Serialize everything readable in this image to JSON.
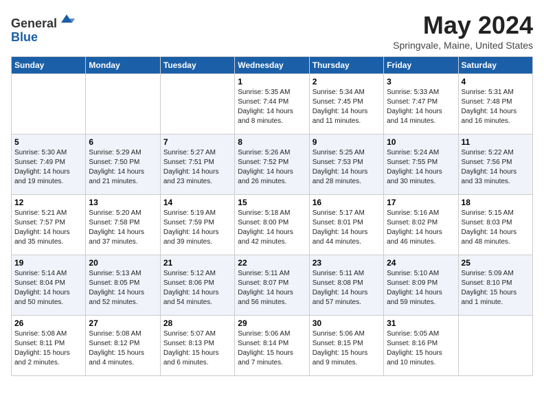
{
  "header": {
    "logo_line1": "General",
    "logo_line2": "Blue",
    "month_title": "May 2024",
    "location": "Springvale, Maine, United States"
  },
  "weekdays": [
    "Sunday",
    "Monday",
    "Tuesday",
    "Wednesday",
    "Thursday",
    "Friday",
    "Saturday"
  ],
  "weeks": [
    [
      {
        "day": "",
        "content": ""
      },
      {
        "day": "",
        "content": ""
      },
      {
        "day": "",
        "content": ""
      },
      {
        "day": "1",
        "content": "Sunrise: 5:35 AM\nSunset: 7:44 PM\nDaylight: 14 hours\nand 8 minutes."
      },
      {
        "day": "2",
        "content": "Sunrise: 5:34 AM\nSunset: 7:45 PM\nDaylight: 14 hours\nand 11 minutes."
      },
      {
        "day": "3",
        "content": "Sunrise: 5:33 AM\nSunset: 7:47 PM\nDaylight: 14 hours\nand 14 minutes."
      },
      {
        "day": "4",
        "content": "Sunrise: 5:31 AM\nSunset: 7:48 PM\nDaylight: 14 hours\nand 16 minutes."
      }
    ],
    [
      {
        "day": "5",
        "content": "Sunrise: 5:30 AM\nSunset: 7:49 PM\nDaylight: 14 hours\nand 19 minutes."
      },
      {
        "day": "6",
        "content": "Sunrise: 5:29 AM\nSunset: 7:50 PM\nDaylight: 14 hours\nand 21 minutes."
      },
      {
        "day": "7",
        "content": "Sunrise: 5:27 AM\nSunset: 7:51 PM\nDaylight: 14 hours\nand 23 minutes."
      },
      {
        "day": "8",
        "content": "Sunrise: 5:26 AM\nSunset: 7:52 PM\nDaylight: 14 hours\nand 26 minutes."
      },
      {
        "day": "9",
        "content": "Sunrise: 5:25 AM\nSunset: 7:53 PM\nDaylight: 14 hours\nand 28 minutes."
      },
      {
        "day": "10",
        "content": "Sunrise: 5:24 AM\nSunset: 7:55 PM\nDaylight: 14 hours\nand 30 minutes."
      },
      {
        "day": "11",
        "content": "Sunrise: 5:22 AM\nSunset: 7:56 PM\nDaylight: 14 hours\nand 33 minutes."
      }
    ],
    [
      {
        "day": "12",
        "content": "Sunrise: 5:21 AM\nSunset: 7:57 PM\nDaylight: 14 hours\nand 35 minutes."
      },
      {
        "day": "13",
        "content": "Sunrise: 5:20 AM\nSunset: 7:58 PM\nDaylight: 14 hours\nand 37 minutes."
      },
      {
        "day": "14",
        "content": "Sunrise: 5:19 AM\nSunset: 7:59 PM\nDaylight: 14 hours\nand 39 minutes."
      },
      {
        "day": "15",
        "content": "Sunrise: 5:18 AM\nSunset: 8:00 PM\nDaylight: 14 hours\nand 42 minutes."
      },
      {
        "day": "16",
        "content": "Sunrise: 5:17 AM\nSunset: 8:01 PM\nDaylight: 14 hours\nand 44 minutes."
      },
      {
        "day": "17",
        "content": "Sunrise: 5:16 AM\nSunset: 8:02 PM\nDaylight: 14 hours\nand 46 minutes."
      },
      {
        "day": "18",
        "content": "Sunrise: 5:15 AM\nSunset: 8:03 PM\nDaylight: 14 hours\nand 48 minutes."
      }
    ],
    [
      {
        "day": "19",
        "content": "Sunrise: 5:14 AM\nSunset: 8:04 PM\nDaylight: 14 hours\nand 50 minutes."
      },
      {
        "day": "20",
        "content": "Sunrise: 5:13 AM\nSunset: 8:05 PM\nDaylight: 14 hours\nand 52 minutes."
      },
      {
        "day": "21",
        "content": "Sunrise: 5:12 AM\nSunset: 8:06 PM\nDaylight: 14 hours\nand 54 minutes."
      },
      {
        "day": "22",
        "content": "Sunrise: 5:11 AM\nSunset: 8:07 PM\nDaylight: 14 hours\nand 56 minutes."
      },
      {
        "day": "23",
        "content": "Sunrise: 5:11 AM\nSunset: 8:08 PM\nDaylight: 14 hours\nand 57 minutes."
      },
      {
        "day": "24",
        "content": "Sunrise: 5:10 AM\nSunset: 8:09 PM\nDaylight: 14 hours\nand 59 minutes."
      },
      {
        "day": "25",
        "content": "Sunrise: 5:09 AM\nSunset: 8:10 PM\nDaylight: 15 hours\nand 1 minute."
      }
    ],
    [
      {
        "day": "26",
        "content": "Sunrise: 5:08 AM\nSunset: 8:11 PM\nDaylight: 15 hours\nand 2 minutes."
      },
      {
        "day": "27",
        "content": "Sunrise: 5:08 AM\nSunset: 8:12 PM\nDaylight: 15 hours\nand 4 minutes."
      },
      {
        "day": "28",
        "content": "Sunrise: 5:07 AM\nSunset: 8:13 PM\nDaylight: 15 hours\nand 6 minutes."
      },
      {
        "day": "29",
        "content": "Sunrise: 5:06 AM\nSunset: 8:14 PM\nDaylight: 15 hours\nand 7 minutes."
      },
      {
        "day": "30",
        "content": "Sunrise: 5:06 AM\nSunset: 8:15 PM\nDaylight: 15 hours\nand 9 minutes."
      },
      {
        "day": "31",
        "content": "Sunrise: 5:05 AM\nSunset: 8:16 PM\nDaylight: 15 hours\nand 10 minutes."
      },
      {
        "day": "",
        "content": ""
      }
    ]
  ]
}
